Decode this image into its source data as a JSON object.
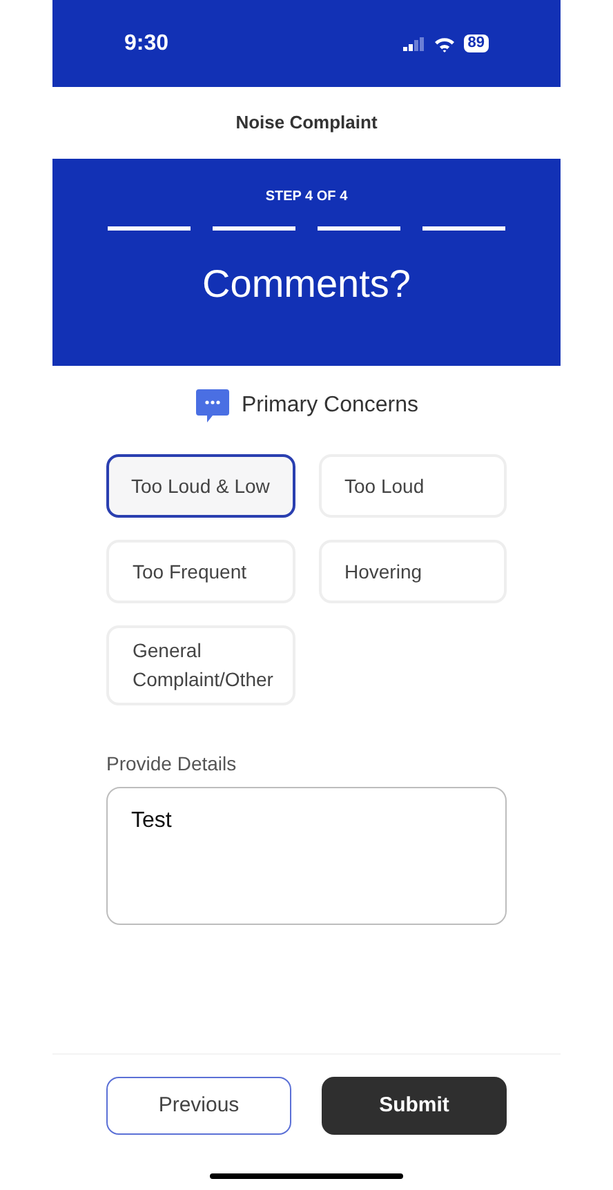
{
  "status_bar": {
    "time": "9:30",
    "battery": "89"
  },
  "header": {
    "title": "Noise Complaint"
  },
  "banner": {
    "step": "STEP 4 OF 4",
    "segments": [
      {
        "complete": true
      },
      {
        "complete": true
      },
      {
        "complete": true
      },
      {
        "complete": true
      }
    ],
    "heading": "Comments?"
  },
  "section": {
    "title": "Primary Concerns"
  },
  "concerns": [
    {
      "label": "Too Loud & Low",
      "selected": true
    },
    {
      "label": "Too Loud",
      "selected": false
    },
    {
      "label": "Too Frequent",
      "selected": false
    },
    {
      "label": "Hovering",
      "selected": false
    },
    {
      "label": "General Complaint/Other",
      "selected": false
    }
  ],
  "details": {
    "label": "Provide Details",
    "value": "Test"
  },
  "buttons": {
    "previous": "Previous",
    "submit": "Submit"
  }
}
